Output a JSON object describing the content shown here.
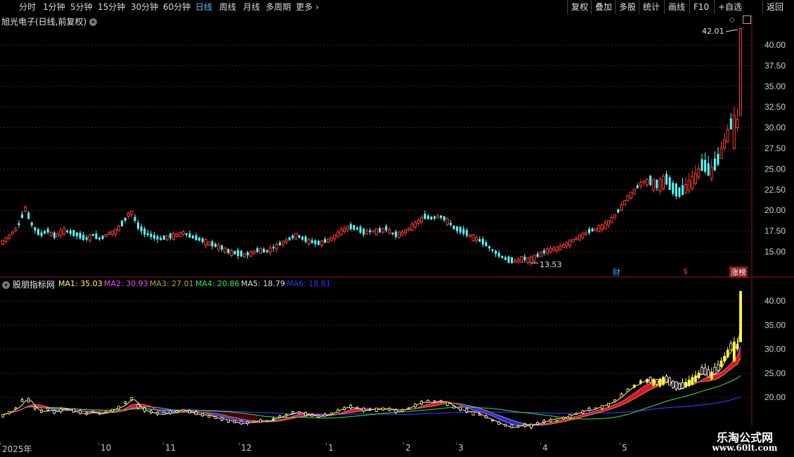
{
  "toolbar": {
    "periods": [
      "分时",
      "1分钟",
      "5分钟",
      "15分钟",
      "30分钟",
      "60分钟",
      "日线",
      "周线",
      "月线",
      "多周期",
      "更多 ›"
    ],
    "active_period": "日线",
    "actions": [
      "复权",
      "叠加",
      "多股",
      "统计",
      "画线",
      "F10",
      "+自选",
      "返回"
    ]
  },
  "main": {
    "stock_title": "旭光电子(日线,前复权)",
    "high_annotation": "42.01",
    "low_annotation": "13.53",
    "tag_finance": "财",
    "tag_dollar": "$",
    "tag_limit": "涨榜"
  },
  "sub": {
    "indicator_name": "股朋指标网",
    "ma": [
      {
        "label": "MA1: 35.03",
        "color": "#ffff55"
      },
      {
        "label": "MA2: 30.93",
        "color": "#ff44ff"
      },
      {
        "label": "MA3: 27.01",
        "color": "#aaaa22"
      },
      {
        "label": "MA4: 20.86",
        "color": "#33ee33"
      },
      {
        "label": "MA5: 18.79",
        "color": "#dddddd"
      },
      {
        "label": "MA6: 18.81",
        "color": "#3333ff"
      }
    ]
  },
  "chart_data": {
    "type": "candlestick",
    "y_axis": [
      15,
      17.5,
      20,
      22.5,
      25,
      27.5,
      30,
      32.5,
      35,
      37.5,
      40
    ],
    "sub_y_axis": [
      20,
      25,
      30,
      35,
      40
    ],
    "date_labels": [
      "2025年",
      "10",
      "11",
      "12",
      "1",
      "2",
      "3",
      "4",
      "5"
    ],
    "price_path": [
      16.2,
      17.0,
      18.0,
      20.2,
      18.0,
      17.0,
      17.5,
      16.8,
      17.6,
      17.3,
      17.0,
      16.5,
      17.0,
      16.5,
      17.2,
      17.5,
      18.5,
      20.0,
      18.0,
      17.2,
      16.8,
      16.5,
      16.8,
      17.0,
      17.3,
      16.8,
      16.5,
      16.2,
      15.8,
      15.5,
      15.0,
      14.8,
      14.6,
      14.8,
      15.2,
      15.0,
      15.5,
      16.0,
      16.5,
      17.0,
      16.5,
      16.2,
      16.0,
      16.3,
      16.8,
      17.5,
      18.0,
      17.8,
      17.3,
      17.5,
      17.5,
      17.8,
      17.0,
      17.2,
      17.8,
      18.5,
      19.2,
      19.0,
      19.3,
      18.8,
      17.8,
      17.5,
      17.0,
      16.5,
      16.0,
      15.2,
      14.5,
      14.0,
      13.8,
      14.2,
      14.0,
      14.5,
      15.0,
      15.3,
      15.5,
      16.0,
      16.5,
      17.0,
      17.5,
      17.8,
      18.2,
      19.0,
      20.2,
      21.5,
      22.5,
      23.5,
      23.5,
      23.0,
      23.8,
      22.5,
      22.0,
      23.0,
      24.0,
      25.5,
      24.5,
      26.0,
      28.5,
      31.0,
      30.0
    ]
  }
}
